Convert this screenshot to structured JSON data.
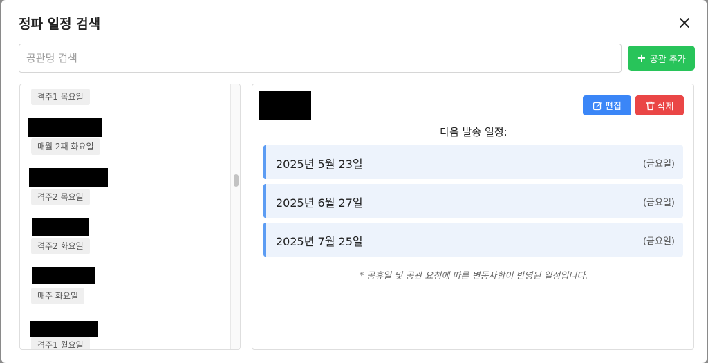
{
  "modal": {
    "title": "정파 일정 검색",
    "search_placeholder": "공관명 검색",
    "add_button": "공관 추가"
  },
  "list": {
    "items": [
      {
        "tag": "격주1 목요일"
      },
      {
        "tag": "매월 2째 화요일"
      },
      {
        "tag": "격주2 목요일"
      },
      {
        "tag": "격주2 화요일"
      },
      {
        "tag": "매주 화요일"
      },
      {
        "tag": "격주1 월요일"
      }
    ]
  },
  "detail": {
    "edit_button": "편집",
    "delete_button": "삭제",
    "next_schedule_title": "다음 발송 일정:",
    "dates": [
      {
        "date": "2025년 5월 23일",
        "weekday": "(금요일)"
      },
      {
        "date": "2025년 6월 27일",
        "weekday": "(금요일)"
      },
      {
        "date": "2025년 7월 25일",
        "weekday": "(금요일)"
      }
    ],
    "note": "* 공휴일 및 공관 요청에 따른 변동사항이 반영된 일정입니다."
  },
  "colors": {
    "add_button": "#28c45a",
    "edit_button": "#3b86f7",
    "delete_button": "#ea4646",
    "date_accent": "#5c9cf3",
    "date_bg": "#edf3fc"
  },
  "icons": {
    "close": "close-icon",
    "plus": "plus-icon",
    "edit": "edit-icon",
    "delete": "trash-icon"
  }
}
